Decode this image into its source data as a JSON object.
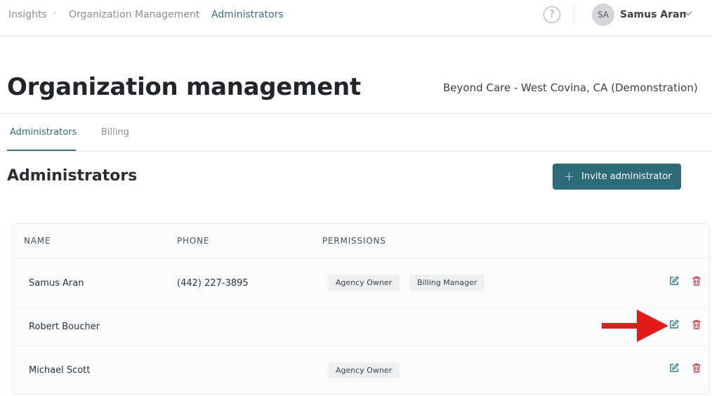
{
  "breadcrumb": {
    "items": [
      "Insights",
      "Organization Management",
      "Administrators"
    ],
    "separator": "·"
  },
  "header": {
    "help_icon": "question-circle-icon",
    "user_initials": "SA",
    "user_name": "Samus Aran"
  },
  "page": {
    "title": "Organization management",
    "organization": "Beyond Care - West Covina, CA (Demonstration)"
  },
  "tabs": [
    {
      "label": "Administrators",
      "active": true
    },
    {
      "label": "Billing",
      "active": false
    }
  ],
  "section": {
    "title": "Administrators",
    "invite_label": "Invite administrator"
  },
  "table": {
    "headers": [
      "NAME",
      "PHONE",
      "PERMISSIONS"
    ],
    "rows": [
      {
        "name": "Samus Aran",
        "phone": "(442) 227-3895",
        "permissions": [
          "Agency Owner",
          "Billing Manager"
        ]
      },
      {
        "name": "Robert Boucher",
        "phone": "",
        "permissions": []
      },
      {
        "name": "Michael Scott",
        "phone": "",
        "permissions": [
          "Agency Owner"
        ]
      }
    ]
  },
  "colors": {
    "accent": "#2e6b78",
    "delete": "#d0434f",
    "edit": "#2e7a86",
    "annotation_arrow": "#e31b1b"
  }
}
